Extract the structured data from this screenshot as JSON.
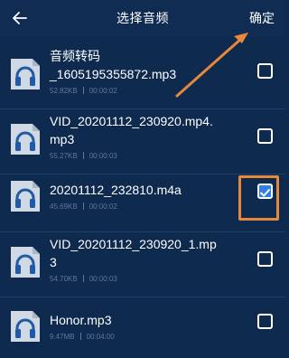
{
  "header": {
    "title": "选择音频",
    "confirm_label": "确定"
  },
  "files": [
    {
      "name": "音频转码_1605195355872.mp3",
      "name_line1": "音频转码",
      "name_line2": "_1605195355872.mp3",
      "size": "52.82KB",
      "duration": "00:00:02",
      "checked": false
    },
    {
      "name": "VID_20201112_230920.mp4.mp3",
      "name_line1": "VID_20201112_230920.mp4.",
      "name_line2": "mp3",
      "size": "55.27KB",
      "duration": "00:00:03",
      "checked": false
    },
    {
      "name": "20201112_232810.m4a",
      "name_line1": "20201112_232810.m4a",
      "name_line2": "",
      "size": "45.69KB",
      "duration": "00:00:02",
      "checked": true
    },
    {
      "name": "VID_20201112_230920_1.mp3",
      "name_line1": "VID_20201112_230920_1.mp",
      "name_line2": "3",
      "size": "54.70KB",
      "duration": "00:00:03",
      "checked": false
    },
    {
      "name": "Honor.mp3",
      "name_line1": "Honor.mp3",
      "name_line2": "",
      "size": "9.47MB",
      "duration": "00:04:00",
      "checked": false
    }
  ],
  "icons": {
    "back": "arrow-left-icon",
    "file": "headphones-file-icon"
  },
  "colors": {
    "background": "#0f2a4f",
    "checkbox_checked": "#2f7fe6",
    "annotation": "#e8883a",
    "meta_text": "#5f7898"
  }
}
